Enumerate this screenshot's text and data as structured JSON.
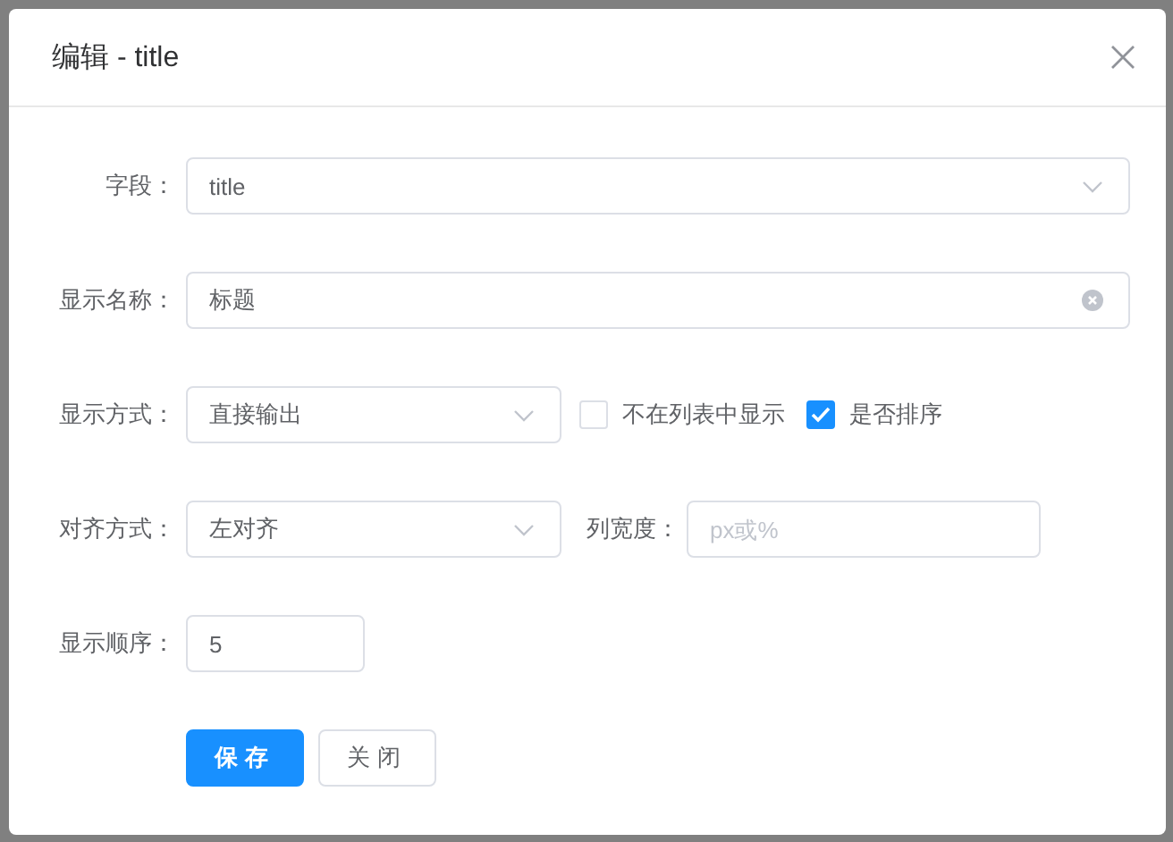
{
  "dialog": {
    "title": "编辑 - title"
  },
  "rows": [
    {
      "label": "字段：",
      "controls": [
        {
          "kind": "select",
          "value": "title"
        }
      ]
    },
    {
      "label": "显示名称：",
      "controls": [
        {
          "kind": "text_clearable",
          "value": "标题"
        }
      ]
    },
    {
      "label": "显示方式：",
      "controls": [
        {
          "kind": "select",
          "value": "直接输出"
        },
        {
          "kind": "checkbox",
          "label": "不在列表中显示",
          "checked": false
        },
        {
          "kind": "checkbox",
          "label": "是否排序",
          "checked": true
        }
      ]
    },
    {
      "label": "对齐方式：",
      "controls": [
        {
          "kind": "select",
          "value": "左对齐"
        },
        {
          "kind": "text",
          "label": "列宽度：",
          "placeholder": "px或%"
        }
      ]
    },
    {
      "label": "显示顺序：",
      "controls": [
        {
          "kind": "number",
          "value": "5"
        }
      ]
    }
  ],
  "buttons": [
    {
      "label": "保存",
      "kind": "primary"
    },
    {
      "label": "关闭",
      "kind": "default"
    }
  ]
}
